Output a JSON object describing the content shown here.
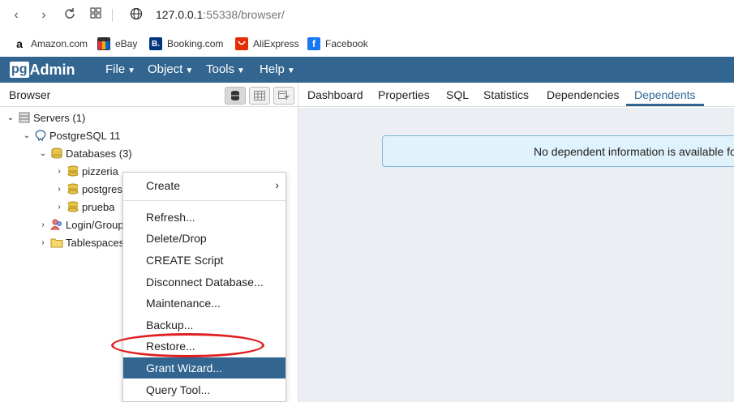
{
  "browser": {
    "url_host": "127.0.0.1",
    "url_path": ":55338/browser/",
    "bookmarks": [
      {
        "label": "Amazon.com",
        "icon": "amazon-icon",
        "color": "#111111"
      },
      {
        "label": "eBay",
        "icon": "ebay-icon",
        "color": "#e53238"
      },
      {
        "label": "Booking.com",
        "icon": "booking-icon",
        "color": "#003580"
      },
      {
        "label": "AliExpress",
        "icon": "aliexpress-icon",
        "color": "#e62e04"
      },
      {
        "label": "Facebook",
        "icon": "facebook-icon",
        "color": "#1877f2"
      }
    ]
  },
  "app": {
    "logo_pg": "pg",
    "logo_admin": "Admin",
    "accent": "#326690",
    "menus": [
      "File",
      "Object",
      "Tools",
      "Help"
    ]
  },
  "browser_panel": {
    "title": "Browser",
    "tree": [
      {
        "label": "Servers (1)",
        "icon": "servers-icon"
      },
      {
        "label": "PostgreSQL 11",
        "icon": "postgresql-elephant-icon"
      },
      {
        "label": "Databases (3)",
        "icon": "databases-icon"
      },
      {
        "label": "pizzeria",
        "icon": "database-icon",
        "selected": true
      },
      {
        "label": "postgres",
        "icon": "database-icon"
      },
      {
        "label": "prueba",
        "icon": "database-icon"
      },
      {
        "label": "Login/Group Roles",
        "icon": "login-roles-icon"
      },
      {
        "label": "Tablespaces",
        "icon": "tablespaces-icon"
      }
    ]
  },
  "tabs": [
    "Dashboard",
    "Properties",
    "SQL",
    "Statistics",
    "Dependencies",
    "Dependents"
  ],
  "active_tab": "Dependents",
  "info_message": "No dependent information is available for the selected object.",
  "context_menu": {
    "items": [
      "Create",
      "Refresh...",
      "Delete/Drop",
      "CREATE Script",
      "Disconnect Database...",
      "Maintenance...",
      "Backup...",
      "Restore...",
      "Grant Wizard...",
      "Query Tool..."
    ],
    "highlighted": "Grant Wizard...",
    "annotated": "Restore...",
    "annotation_color": "#e02020"
  }
}
